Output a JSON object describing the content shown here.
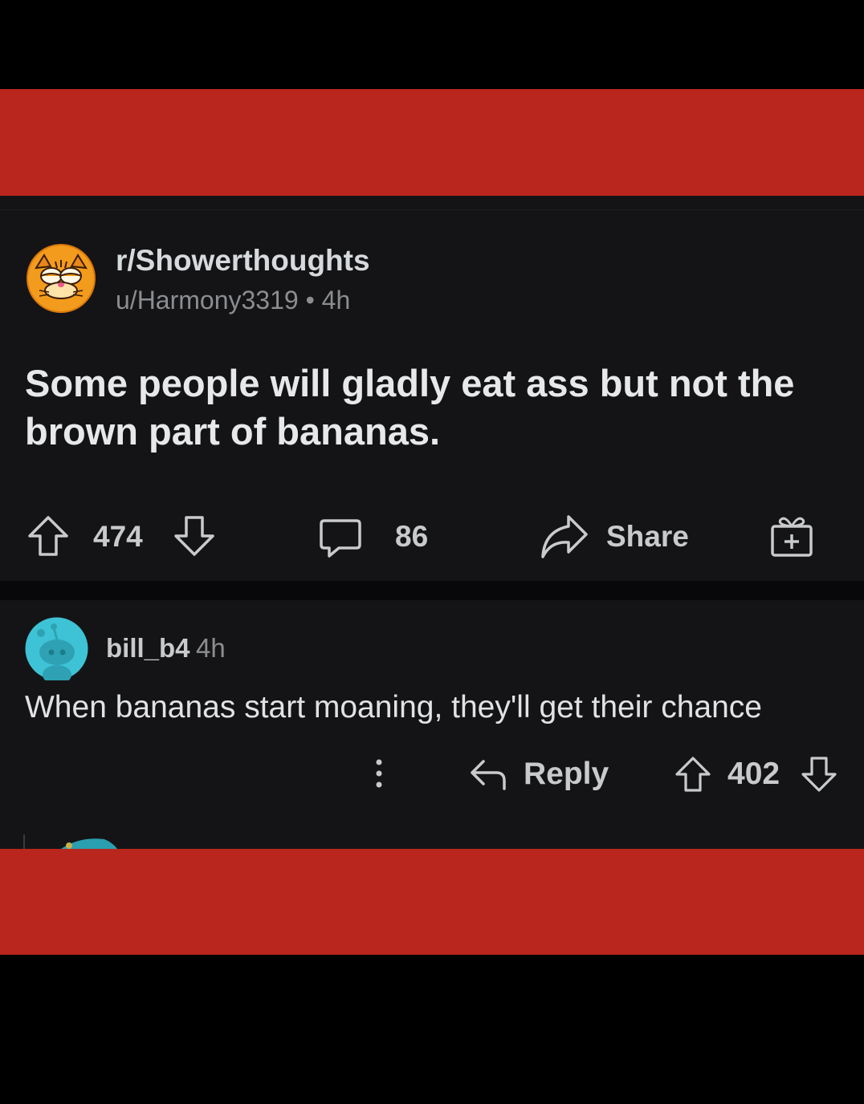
{
  "colors": {
    "page_bg": "#000000",
    "red_band": "#b9261d",
    "card_bg": "#141416",
    "primary_text": "#d7dadc",
    "secondary_text": "#8b8d90",
    "garfield_orange": "#f39b1c",
    "snoo_cyan": "#3ec3d6"
  },
  "post": {
    "subreddit": "r/Showerthoughts",
    "meta": "u/Harmony3319 • 4h",
    "title": "Some people will gladly eat ass but not the brown part of bananas.",
    "score": "474",
    "comments_count": "86",
    "share_label": "Share",
    "icons": [
      "garfield-avatar",
      "upvote-icon",
      "downvote-icon",
      "comment-icon",
      "share-icon",
      "gift-icon"
    ]
  },
  "comment": {
    "username": "bill_b4",
    "time": "4h",
    "text": "When bananas start moaning, they'll get their chance",
    "reply_label": "Reply",
    "score": "402",
    "icons": [
      "snoo-avatar",
      "more-icon",
      "reply-icon",
      "upvote-icon",
      "downvote-icon"
    ]
  }
}
